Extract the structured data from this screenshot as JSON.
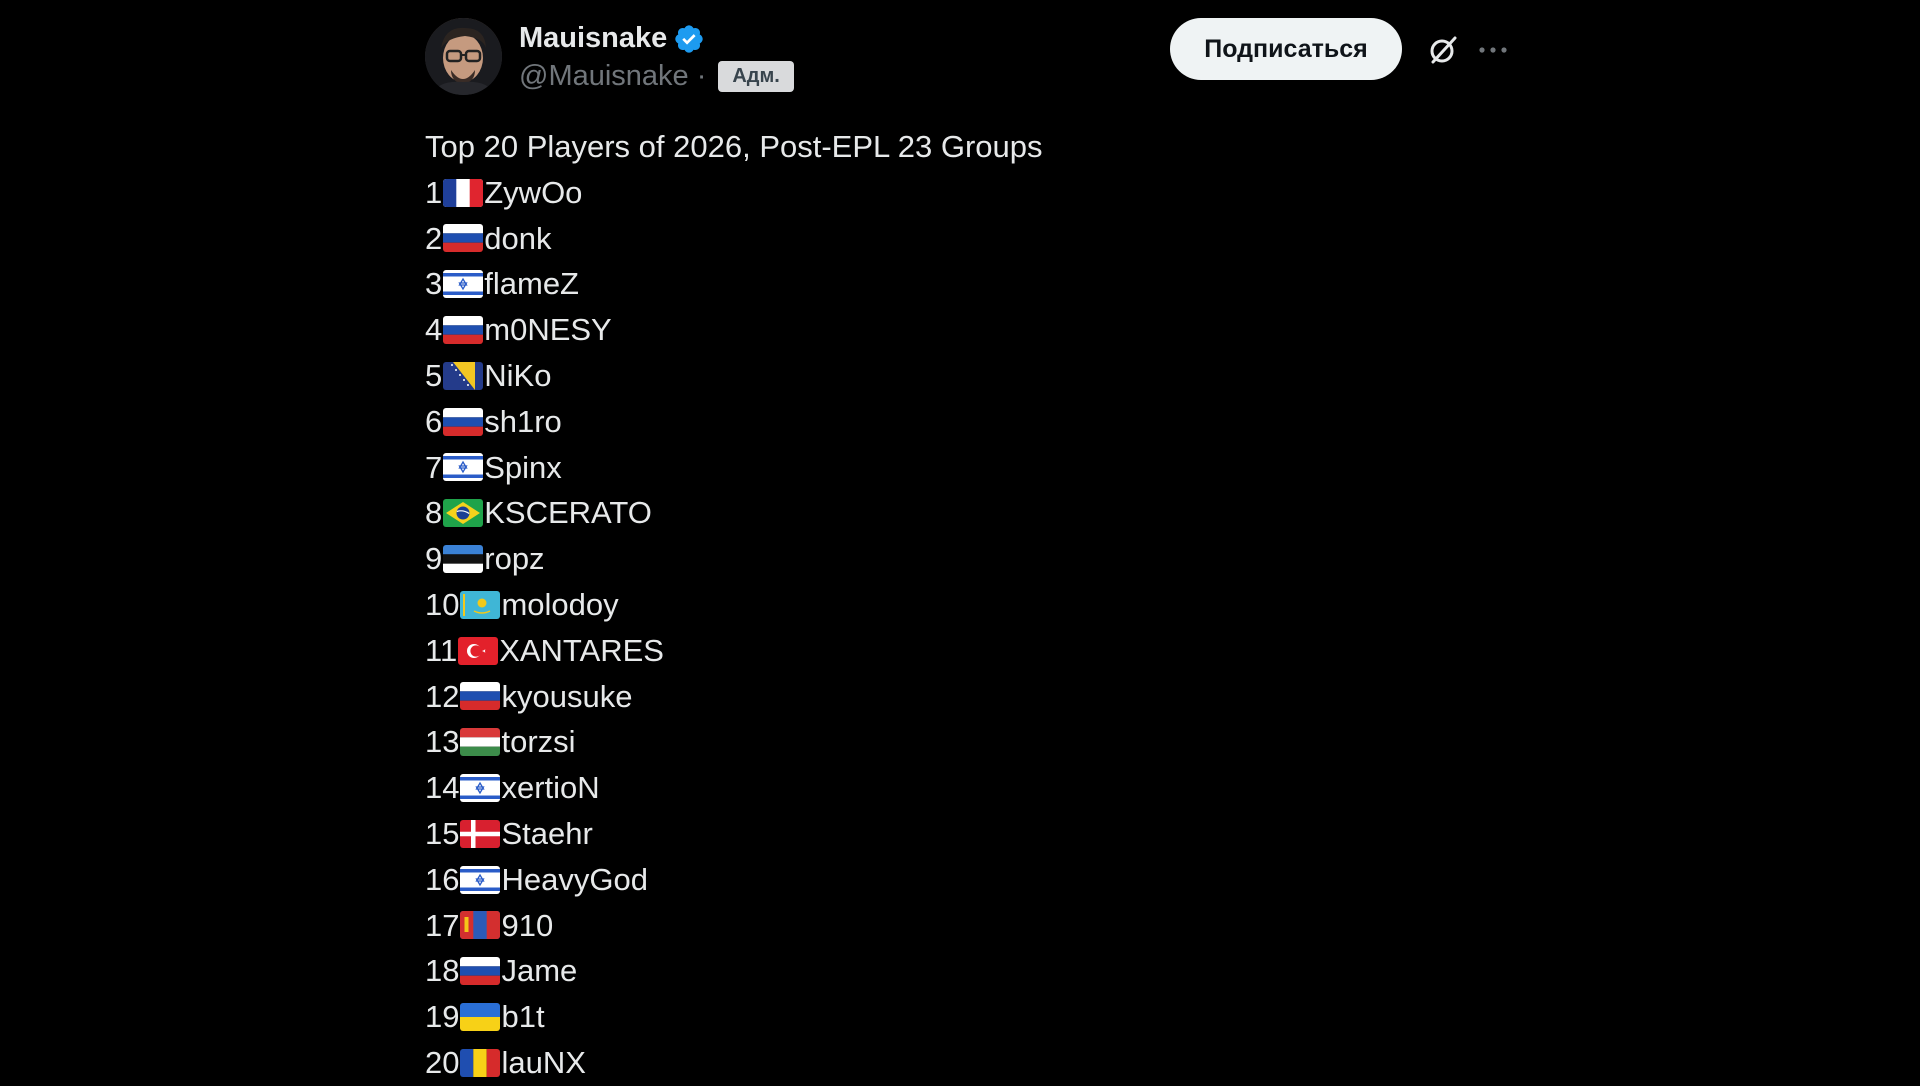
{
  "author": {
    "display_name": "Mauisnake",
    "handle": "@Mauisnake",
    "separator": "·",
    "badge": "Адм.",
    "verified_color": "#1d9bf0"
  },
  "actions": {
    "follow_label": "Подписаться",
    "grok_icon": "grok-icon",
    "more_icon": "more-icon"
  },
  "post": {
    "title": "Top 20 Players of 2026, Post-EPL 23 Groups",
    "players": [
      {
        "rank": "1",
        "flag": "france",
        "name": "ZywOo"
      },
      {
        "rank": "2",
        "flag": "russia",
        "name": "donk"
      },
      {
        "rank": "3",
        "flag": "israel",
        "name": "flameZ"
      },
      {
        "rank": "4",
        "flag": "russia",
        "name": "m0NESY"
      },
      {
        "rank": "5",
        "flag": "bosnia",
        "name": "NiKo"
      },
      {
        "rank": "6",
        "flag": "russia",
        "name": "sh1ro"
      },
      {
        "rank": "7",
        "flag": "israel",
        "name": "Spinx"
      },
      {
        "rank": "8",
        "flag": "brazil",
        "name": "KSCERATO"
      },
      {
        "rank": "9",
        "flag": "estonia",
        "name": "ropz"
      },
      {
        "rank": "10",
        "flag": "kazakhstan",
        "name": "molodoy"
      },
      {
        "rank": "11",
        "flag": "turkey",
        "name": "XANTARES"
      },
      {
        "rank": "12",
        "flag": "russia",
        "name": "kyousuke"
      },
      {
        "rank": "13",
        "flag": "hungary",
        "name": "torzsi"
      },
      {
        "rank": "14",
        "flag": "israel",
        "name": "xertioN"
      },
      {
        "rank": "15",
        "flag": "denmark",
        "name": "Staehr"
      },
      {
        "rank": "16",
        "flag": "israel",
        "name": "HeavyGod"
      },
      {
        "rank": "17",
        "flag": "mongolia",
        "name": "910"
      },
      {
        "rank": "18",
        "flag": "russia",
        "name": "Jame"
      },
      {
        "rank": "19",
        "flag": "ukraine",
        "name": "b1t"
      },
      {
        "rank": "20",
        "flag": "romania",
        "name": "lauNX"
      }
    ]
  }
}
